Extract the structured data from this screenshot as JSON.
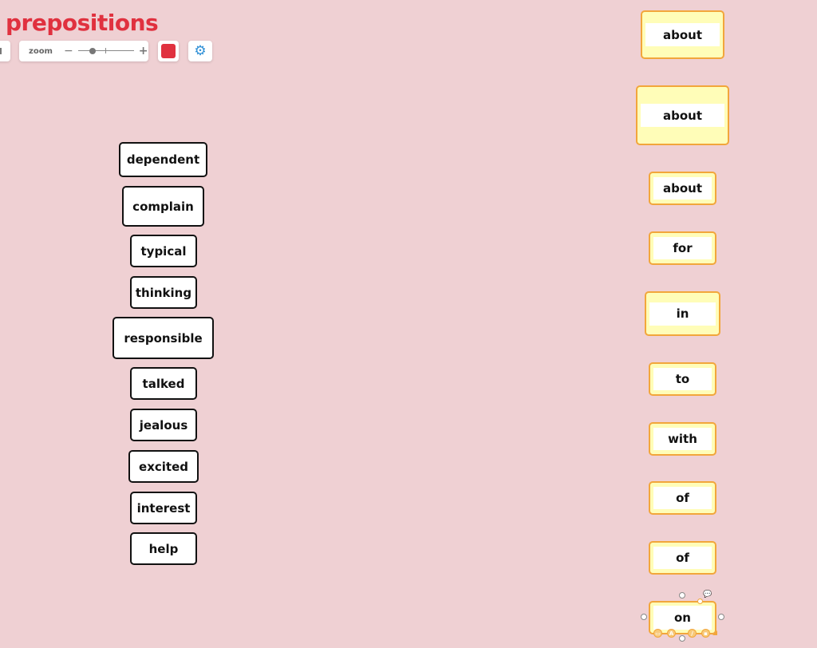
{
  "title": "prepositions",
  "toolbar": {
    "zoom_label": "zoom",
    "zoom_minus": "−",
    "zoom_plus": "+",
    "zoom_level": 0.25,
    "color_swatch": "#e0313f",
    "settings_icon": "gear-icon"
  },
  "words": [
    "dependent",
    "complain",
    "typical",
    "thinking",
    "responsible",
    "talked",
    "jealous",
    "excited",
    "interest",
    "help"
  ],
  "prepositions": [
    "about",
    "about",
    "about",
    "for",
    "in",
    "to",
    "with",
    "of",
    "of",
    "on"
  ],
  "selected_card": {
    "label": "on",
    "tools": [
      "frame-icon",
      "A",
      "pen-icon",
      "image-icon"
    ]
  },
  "colors": {
    "background": "#efd0d3",
    "title": "#e0313f",
    "card_border": "#f2a63b",
    "card_fill": "#fffdb8",
    "accent_blue": "#2e8fd6"
  }
}
